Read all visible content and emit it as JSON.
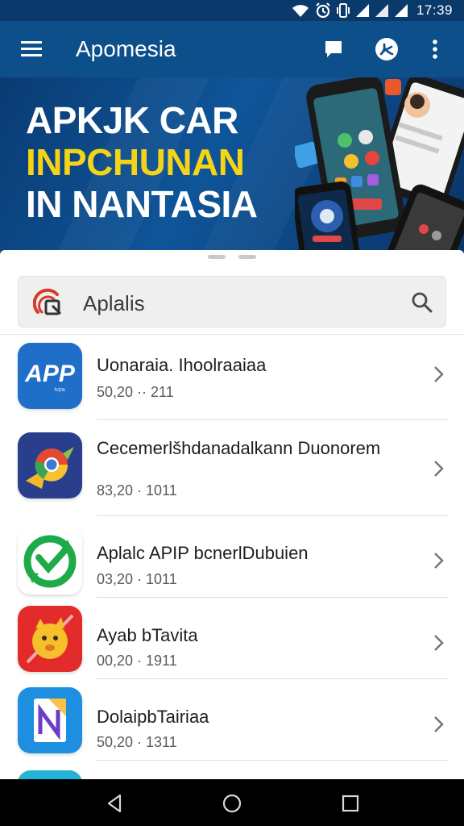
{
  "status_bar": {
    "time": "17:39",
    "icons": [
      "wifi-icon",
      "alarm-icon",
      "vibrate-icon",
      "signal-icon",
      "signal-icon",
      "battery-icon"
    ]
  },
  "app_bar": {
    "title": "Apomesia",
    "actions": [
      "chat-icon",
      "cast-icon",
      "more-vert-icon"
    ],
    "color": "#0d4f8b"
  },
  "banner": {
    "lines": [
      "APKJK CAR",
      "INPCHUNAN",
      "IN NANTASIA"
    ],
    "accent_color": "#f5d316"
  },
  "search": {
    "value": "Aplalis"
  },
  "apps": [
    {
      "name": "Uonaraia. Ihoolraaiaa",
      "meta": "50,20 ·· 211",
      "icon": "app-logo-icon",
      "logo_text": "APP",
      "logo_sub": "tvpa"
    },
    {
      "name": "Cecemerlšhdanadalkann Duonorem",
      "meta": "83,20 · 1011",
      "icon": "chrome-bird-icon"
    },
    {
      "name": "Aplalc APIP bcnerlDubuien",
      "meta": "03,20 · 1011",
      "icon": "green-sync-icon"
    },
    {
      "name": "Ayab bTavita",
      "meta": "00,20 · 1911",
      "icon": "yellow-face-icon"
    },
    {
      "name": "DolaipbTairiaa",
      "meta": "50,20 · 1311",
      "icon": "document-n-icon"
    }
  ],
  "nav_bar": {
    "buttons": [
      "back-icon",
      "home-icon",
      "recents-icon"
    ]
  }
}
